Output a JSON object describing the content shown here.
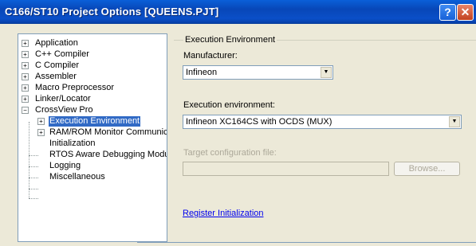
{
  "window": {
    "title": "C166/ST10 Project Options [QUEENS.PJT]",
    "help_glyph": "?",
    "close_glyph": "✕"
  },
  "tree": {
    "expander_glyph": "+",
    "collapse_glyph": "−",
    "items": [
      {
        "label": "Application"
      },
      {
        "label": "C++ Compiler"
      },
      {
        "label": "C Compiler"
      },
      {
        "label": "Assembler"
      },
      {
        "label": "Macro Preprocessor"
      },
      {
        "label": "Linker/Locator"
      },
      {
        "label": "CrossView Pro"
      },
      {
        "label": "Execution Environment"
      },
      {
        "label": "RAM/ROM Monitor Communicat"
      },
      {
        "label": "Initialization"
      },
      {
        "label": "RTOS Aware Debugging Module"
      },
      {
        "label": "Logging"
      },
      {
        "label": "Miscellaneous"
      }
    ]
  },
  "panel": {
    "group_title": "Execution Environment",
    "manufacturer_label": "Manufacturer:",
    "manufacturer_value": "Infineon",
    "exec_env_label": "Execution environment:",
    "exec_env_value": "Infineon XC164CS with OCDS (MUX)",
    "target_config_label": "Target configuration file:",
    "target_config_value": "",
    "browse_label": "Browse...",
    "register_link": "Register Initialization",
    "dropdown_glyph": "▼"
  }
}
